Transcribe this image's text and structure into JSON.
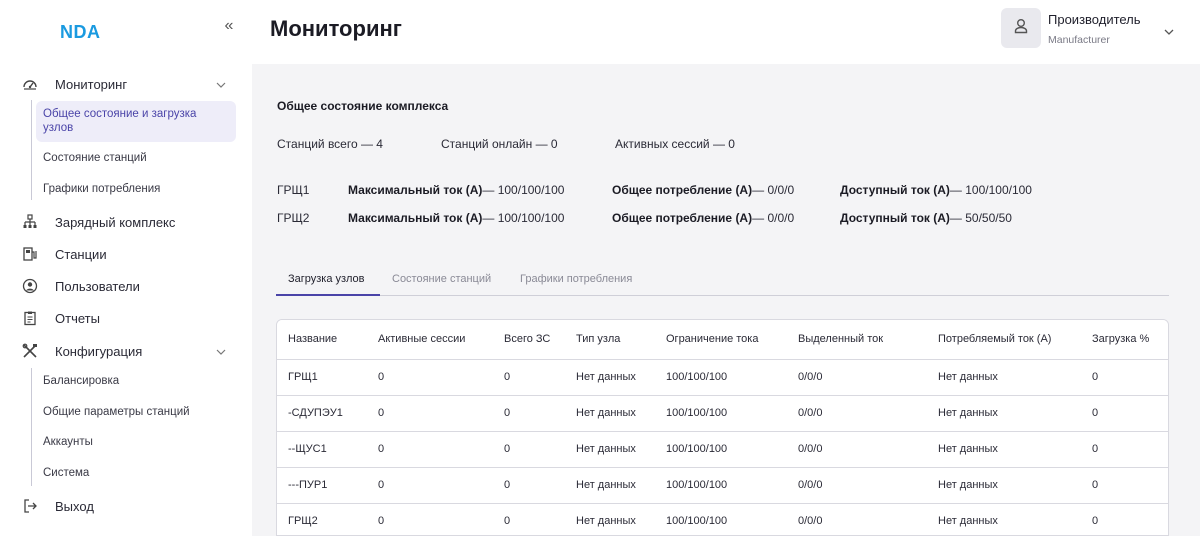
{
  "app": {
    "logo": "NDA"
  },
  "header": {
    "title": "Мониторинг",
    "user_name": "Производитель",
    "user_role": "Manufacturer"
  },
  "sidebar": {
    "collapse_glyph": "«",
    "items": [
      {
        "label": "Мониторинг",
        "icon": "gauge-icon"
      },
      {
        "label": "Зарядный комплекс",
        "icon": "network-icon"
      },
      {
        "label": "Станции",
        "icon": "charging-station-icon"
      },
      {
        "label": "Пользователи",
        "icon": "user-circle-icon"
      },
      {
        "label": "Отчеты",
        "icon": "clipboard-icon"
      },
      {
        "label": "Конфигурация",
        "icon": "tools-icon"
      },
      {
        "label": "Выход",
        "icon": "logout-icon"
      }
    ],
    "monitoring_sub": [
      "Общее состояние и загрузка узлов",
      "Состояние станций",
      "Графики потребления"
    ],
    "config_sub": [
      "Балансировка",
      "Общие параметры станций",
      "Аккаунты",
      "Система"
    ]
  },
  "overview": {
    "title": "Общее состояние комплекса",
    "stations_total": "Станций всего — 4",
    "stations_online": "Станций онлайн — 0",
    "active_sessions": "Активных сессий — 0",
    "groups": [
      {
        "name": "ГРЩ1",
        "max_label": "Максимальный ток (А)",
        "max_val": "— 100/100/100",
        "cons_label": "Общее потребление (А)",
        "cons_val": "— 0/0/0",
        "avail_label": "Доступный ток (А)",
        "avail_val": "— 100/100/100"
      },
      {
        "name": "ГРЩ2",
        "max_label": "Максимальный ток (А)",
        "max_val": "— 100/100/100",
        "cons_label": "Общее потребление (А)",
        "cons_val": "— 0/0/0",
        "avail_label": "Доступный ток (А)",
        "avail_val": "— 50/50/50"
      }
    ]
  },
  "tabs": [
    "Загрузка узлов",
    "Состояние станций",
    "Графики потребления"
  ],
  "table": {
    "headers": [
      "Название",
      "Активные сессии",
      "Всего ЗС",
      "Тип узла",
      "Ограничение тока",
      "Выделенный ток",
      "Потребляемый ток (А)",
      "Загрузка %"
    ],
    "rows": [
      [
        "ГРЩ1",
        "0",
        "0",
        "Нет данных",
        "100/100/100",
        "0/0/0",
        "Нет данных",
        "0"
      ],
      [
        "-СДУПЭУ1",
        "0",
        "0",
        "Нет данных",
        "100/100/100",
        "0/0/0",
        "Нет данных",
        "0"
      ],
      [
        "--ЩУС1",
        "0",
        "0",
        "Нет данных",
        "100/100/100",
        "0/0/0",
        "Нет данных",
        "0"
      ],
      [
        "---ПУР1",
        "0",
        "0",
        "Нет данных",
        "100/100/100",
        "0/0/0",
        "Нет данных",
        "0"
      ],
      [
        "ГРЩ2",
        "0",
        "0",
        "Нет данных",
        "100/100/100",
        "0/0/0",
        "Нет данных",
        "0"
      ]
    ]
  },
  "colors": {
    "accent": "#4a44a8",
    "logo": "#1a9ae0",
    "panel_bg": "#f4f4f6"
  }
}
